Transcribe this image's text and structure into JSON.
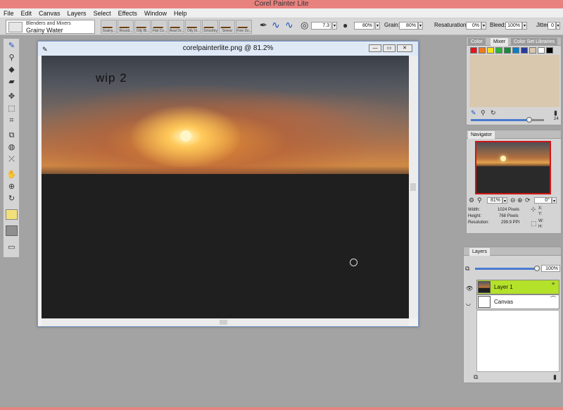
{
  "app": {
    "title": "Corel Painter Lite"
  },
  "menu": [
    "File",
    "Edit",
    "Canvas",
    "Layers",
    "Select",
    "Effects",
    "Window",
    "Help"
  ],
  "brush": {
    "category": "Blenders and Mixers",
    "variant": "Grainy Water"
  },
  "variants": [
    "Grainy...",
    "Round...",
    "Oily Bl...",
    "Flat Co...",
    "Real Dr...",
    "Oily bl...",
    "Smoothy",
    "Smear",
    "Fine So..."
  ],
  "props": {
    "size_value": "7.3",
    "opacity_value": "80%",
    "grain_label": "Grain:",
    "grain_value": "80%",
    "resaturation_label": "Resaturation:",
    "resaturation_value": "0%",
    "bleed_label": "Bleed:",
    "bleed_value": "100%",
    "jitter_label": "Jitter:",
    "jitter_value": "0"
  },
  "document": {
    "title": "corelpainterlite.png @ 81.2%",
    "annotation": "wip 2"
  },
  "mixer_panel": {
    "tabs": [
      "Color",
      "Mixer",
      "Color Set Libraries"
    ],
    "swatches": [
      "#e8141b",
      "#f07a1a",
      "#f6e21a",
      "#29b33a",
      "#188a3a",
      "#0a7fc8",
      "#2a3a9a",
      "#d9c7ae",
      "#ffffff",
      "#000000"
    ],
    "mix_color": "#d9c7ae",
    "slider_value": "24"
  },
  "navigator_panel": {
    "title": "Navigator",
    "zoom": "81%",
    "rotation": "0°",
    "width_label": "Width:",
    "width_value": "1024 Pixels",
    "height_label": "Height:",
    "height_value": "768 Pixels",
    "resolution_label": "Resolution:",
    "resolution_value": "299.9 PPI",
    "x_label": "X:",
    "y_label": "Y:",
    "w_label": "W:",
    "h_label": "H:"
  },
  "layers_panel": {
    "title": "Layers",
    "opacity": "100%",
    "layers": [
      {
        "name": "Layer 1",
        "selected": true
      },
      {
        "name": "Canvas",
        "selected": false
      }
    ]
  },
  "colors": {
    "layer_highlight": "#b4e12a",
    "nav_frame": "#d01515",
    "accent_title": "#e8827f"
  }
}
